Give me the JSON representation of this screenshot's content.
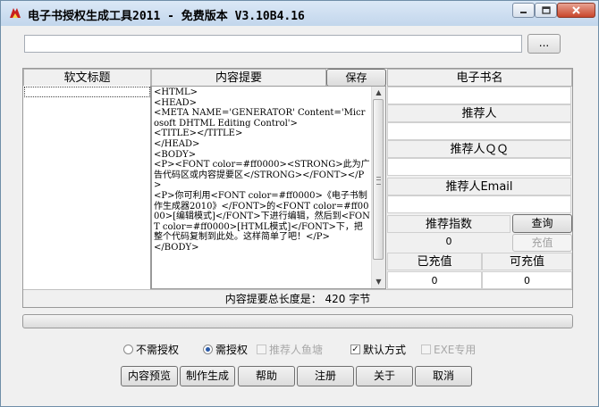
{
  "window": {
    "title": "电子书授权生成工具2011 - 免费版本 V3.10B4.16",
    "browse_label": "...",
    "path_value": ""
  },
  "headers": {
    "software_title": "软文标题",
    "content_summary": "内容提要",
    "save_button": "保存",
    "ebook_name": "电子书名"
  },
  "content_text": "<HTML>\n<HEAD>\n<META NAME='GENERATOR' Content='Microsoft DHTML Editing Control'>\n<TITLE></TITLE>\n</HEAD>\n<BODY>\n<P><FONT color=#ff0000><STRONG>此为广告代码区或内容提要区</STRONG></FONT></P>\n<P>你可利用<FONT color=#ff0000>《电子书制作生成器2010》</FONT>的<FONT color=#ff0000>[编辑模式]</FONT>下进行编辑，然后到<FONT color=#ff0000>[HTML模式]</FONT>下，把整个代码复制到此处。这样简单了吧！</P>\n</BODY>",
  "right_panel": {
    "recommender": "推荐人",
    "recommender_qq": "推荐人ＱＱ",
    "recommender_email": "推荐人Email",
    "recommend_index": "推荐指数",
    "query_button": "查询",
    "recharge_button": "充值",
    "recommend_index_value": "0",
    "recharged_label": "已充值",
    "rechargeable_label": "可充值",
    "recharged_value": "0",
    "rechargeable_value": "0"
  },
  "status_text": "内容提要总长度是： 420 字节",
  "options": {
    "no_auth": "不需授权",
    "need_auth": "需授权",
    "recommender_fish": "推荐人鱼塘",
    "default_mode": "默认方式",
    "exe_only": "EXE专用",
    "selected_radio": "need_auth",
    "default_mode_checked": true
  },
  "buttons": {
    "preview": "内容预览",
    "generate": "制作生成",
    "help": "帮助",
    "register": "注册",
    "about": "关于",
    "cancel": "取消"
  }
}
